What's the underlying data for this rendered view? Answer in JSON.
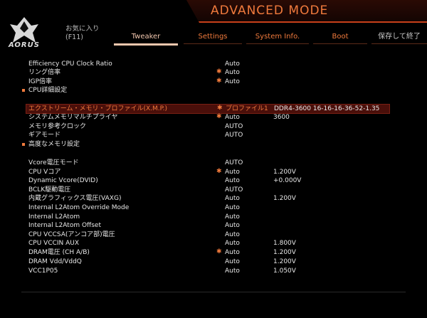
{
  "header": {
    "mode_title": "ADVANCED MODE",
    "logo_text": "AORUS",
    "favorites_line1": "お気に入り",
    "favorites_line2": "(F11)",
    "save_exit": "保存して終了",
    "tabs": [
      {
        "label": "Tweaker",
        "active": true
      },
      {
        "label": "Settings",
        "active": false
      },
      {
        "label": "System Info.",
        "active": false
      },
      {
        "label": "Boot",
        "active": false
      }
    ]
  },
  "rows": [
    {
      "label": "Efficiency CPU Clock Ratio",
      "star": "",
      "value": "Auto",
      "extra": ""
    },
    {
      "label": "リング倍率",
      "star": "✱",
      "value": "Auto",
      "extra": ""
    },
    {
      "label": "IGP倍率",
      "star": "✱",
      "value": "Auto",
      "extra": ""
    },
    {
      "label": "CPU詳細設定",
      "star": "",
      "value": "",
      "extra": "",
      "submenu": true
    },
    {
      "label": "エクストリーム・メモリ・プロファイル(X.M.P.)",
      "star": "✱",
      "value": "プロファイル1",
      "extra": "DDR4-3600 16-16-16-36-52-1.35",
      "highlighted": true
    },
    {
      "label": "システムメモリマルチプライヤ",
      "star": "✱",
      "value": "Auto",
      "extra": "3600"
    },
    {
      "label": "メモリ参考クロック",
      "star": "",
      "value": "AUTO",
      "extra": ""
    },
    {
      "label": "ギアモード",
      "star": "",
      "value": "AUTO",
      "extra": ""
    },
    {
      "label": "高度なメモリ設定",
      "star": "",
      "value": "",
      "extra": "",
      "submenu": true
    },
    {
      "label": "Vcore電圧モード",
      "star": "",
      "value": "AUTO",
      "extra": ""
    },
    {
      "label": "CPU Vコア",
      "star": "✱",
      "value": "Auto",
      "extra": "1.200V"
    },
    {
      "label": "Dynamic Vcore(DVID)",
      "star": "",
      "value": "Auto",
      "extra": "+0.000V"
    },
    {
      "label": "BCLK駆動電圧",
      "star": "",
      "value": "AUTO",
      "extra": ""
    },
    {
      "label": "内蔵グラフィックス電圧(VAXG)",
      "star": "",
      "value": "Auto",
      "extra": "1.200V"
    },
    {
      "label": "Internal L2Atom Override Mode",
      "star": "",
      "value": "Auto",
      "extra": ""
    },
    {
      "label": "Internal L2Atom",
      "star": "",
      "value": "Auto",
      "extra": ""
    },
    {
      "label": "Internal L2Atom Offset",
      "star": "",
      "value": "Auto",
      "extra": ""
    },
    {
      "label": "CPU VCCSA(アンコア部)電圧",
      "star": "",
      "value": "Auto",
      "extra": ""
    },
    {
      "label": "CPU VCCIN AUX",
      "star": "",
      "value": "Auto",
      "extra": "1.800V"
    },
    {
      "label": "DRAM電圧 (CH A/B)",
      "star": "✱",
      "value": "Auto",
      "extra": "1.200V"
    },
    {
      "label": "DRAM Vdd/VddQ",
      "star": "",
      "value": "Auto",
      "extra": "1.200V"
    },
    {
      "label": "VCC1P05",
      "star": "",
      "value": "Auto",
      "extra": "1.050V"
    }
  ],
  "colors": {
    "accent": "#f07a3c",
    "highlight_bg": "#4a0f0a",
    "text": "#e8e8e8"
  }
}
